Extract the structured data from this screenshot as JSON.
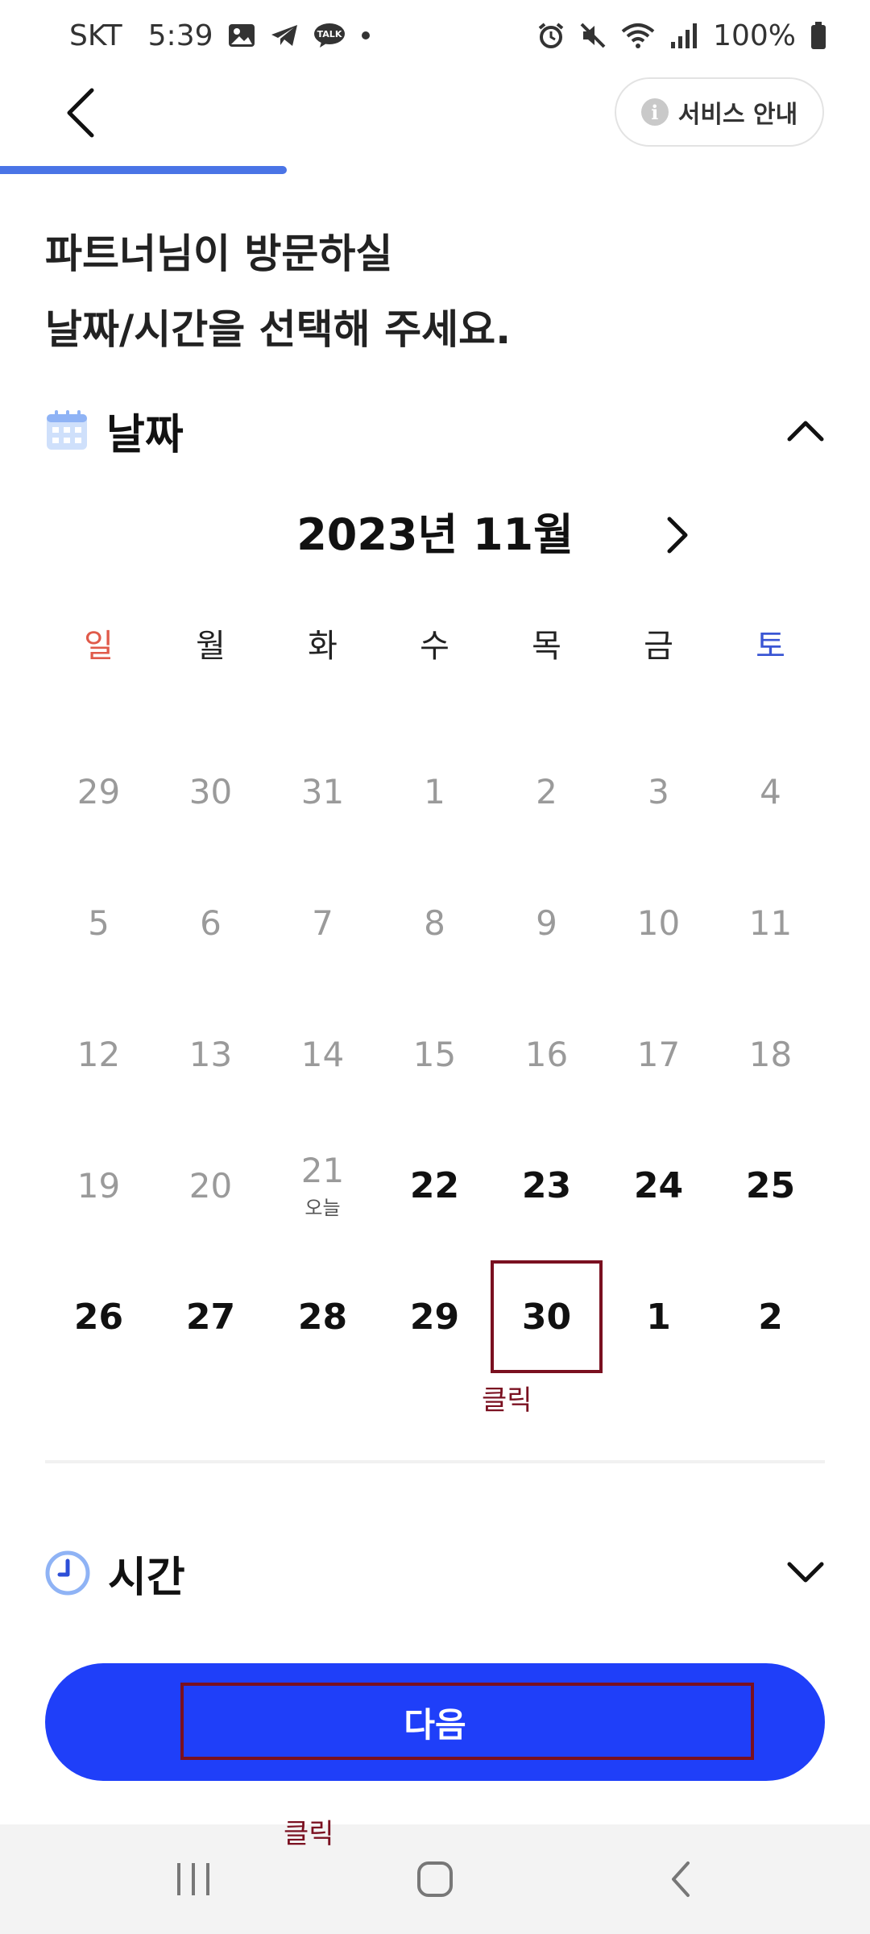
{
  "status_bar": {
    "carrier": "SKT",
    "time": "5:39",
    "battery": "100%",
    "left_icons": [
      "gallery-icon",
      "telegram-icon",
      "kakaotalk-icon",
      "dot-icon"
    ],
    "right_icons": [
      "alarm-icon",
      "mute-icon",
      "wifi-icon",
      "signal-icon",
      "battery-icon"
    ]
  },
  "header": {
    "service_label": "서비스 안내",
    "info_glyph": "i"
  },
  "progress": {
    "fraction": 0.33
  },
  "heading": {
    "line1": "파트너님이 방문하실",
    "line2": "날짜/시간을 선택해 주세요."
  },
  "date_section": {
    "title": "날짜"
  },
  "calendar": {
    "month_label": "2023년 11월",
    "weekdays": [
      "일",
      "월",
      "화",
      "수",
      "목",
      "금",
      "토"
    ],
    "weekday_colors": {
      "sunday": "#e05a4a",
      "saturday": "#3a56d4",
      "default": "#222222"
    },
    "weeks": [
      [
        {
          "d": "29",
          "active": false
        },
        {
          "d": "30",
          "active": false
        },
        {
          "d": "31",
          "active": false
        },
        {
          "d": "1",
          "active": false
        },
        {
          "d": "2",
          "active": false
        },
        {
          "d": "3",
          "active": false
        },
        {
          "d": "4",
          "active": false
        }
      ],
      [
        {
          "d": "5",
          "active": false
        },
        {
          "d": "6",
          "active": false
        },
        {
          "d": "7",
          "active": false
        },
        {
          "d": "8",
          "active": false
        },
        {
          "d": "9",
          "active": false
        },
        {
          "d": "10",
          "active": false
        },
        {
          "d": "11",
          "active": false
        }
      ],
      [
        {
          "d": "12",
          "active": false
        },
        {
          "d": "13",
          "active": false
        },
        {
          "d": "14",
          "active": false
        },
        {
          "d": "15",
          "active": false
        },
        {
          "d": "16",
          "active": false
        },
        {
          "d": "17",
          "active": false
        },
        {
          "d": "18",
          "active": false
        }
      ],
      [
        {
          "d": "19",
          "active": false
        },
        {
          "d": "20",
          "active": false
        },
        {
          "d": "21",
          "active": false,
          "sub": "오늘"
        },
        {
          "d": "22",
          "active": true
        },
        {
          "d": "23",
          "active": true
        },
        {
          "d": "24",
          "active": true
        },
        {
          "d": "25",
          "active": true
        }
      ],
      [
        {
          "d": "26",
          "active": true
        },
        {
          "d": "27",
          "active": true
        },
        {
          "d": "28",
          "active": true
        },
        {
          "d": "29",
          "active": true
        },
        {
          "d": "30",
          "active": true,
          "selected": true
        },
        {
          "d": "1",
          "active": true
        },
        {
          "d": "2",
          "active": true
        }
      ]
    ]
  },
  "annotations": {
    "click_date": "클릭",
    "click_next": "클릭"
  },
  "time_section": {
    "title": "시간"
  },
  "next_button": {
    "label": "다음"
  },
  "colors": {
    "accent": "#1f3ff9",
    "progress": "#4a74e6",
    "annotation": "#7a1020"
  }
}
